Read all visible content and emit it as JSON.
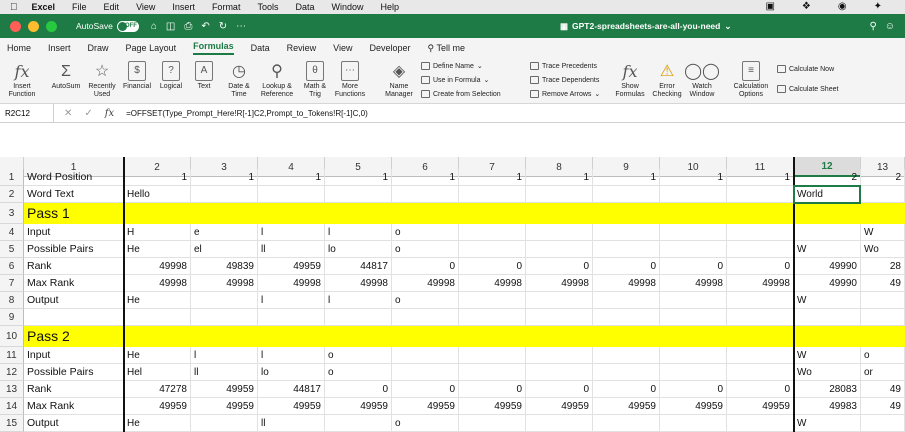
{
  "menubar": {
    "app": "Excel",
    "items": [
      "File",
      "Edit",
      "View",
      "Insert",
      "Format",
      "Tools",
      "Data",
      "Window",
      "Help"
    ]
  },
  "titlebar": {
    "autosave_label": "AutoSave",
    "autosave_state": "OFF",
    "doc_title": "GPT2-spreadsheets-are-all-you-need",
    "traffic_colors": [
      "#ff5f57",
      "#febc2e",
      "#28c840"
    ]
  },
  "tabs": [
    "Home",
    "Insert",
    "Draw",
    "Page Layout",
    "Formulas",
    "Data",
    "Review",
    "View",
    "Developer",
    "Tell me"
  ],
  "active_tab": "Formulas",
  "ribbon": {
    "insert_function": "Insert\nFunction",
    "autosum": "AutoSum",
    "recently_used": "Recently\nUsed",
    "financial": "Financial",
    "logical": "Logical",
    "text": "Text",
    "date_time": "Date &\nTime",
    "lookup": "Lookup &\nReference",
    "math": "Math &\nTrig",
    "more": "More\nFunctions",
    "name_manager": "Name\nManager",
    "define_name": "Define Name",
    "use_in_formula": "Use in Formula",
    "create_from_selection": "Create from Selection",
    "trace_precedents": "Trace Precedents",
    "trace_dependents": "Trace Dependents",
    "remove_arrows": "Remove Arrows",
    "show_formulas": "Show\nFormulas",
    "error_checking": "Error\nChecking",
    "watch_window": "Watch\nWindow",
    "calc_options": "Calculation\nOptions",
    "calculate_now": "Calculate Now",
    "calculate_sheet": "Calculate Sheet"
  },
  "formula_bar": {
    "name_box": "R2C12",
    "fx": "fx",
    "formula": "=OFFSET(Type_Prompt_Here!R[-1]C2,Prompt_to_Tokens!R[-1]C,0)"
  },
  "columns": [
    "1",
    "2",
    "3",
    "4",
    "5",
    "6",
    "7",
    "8",
    "9",
    "10",
    "11",
    "12",
    "13"
  ],
  "selected_column": "12",
  "rows": [
    {
      "num": "1",
      "cells": [
        "Word Position",
        "1",
        "1",
        "1",
        "1",
        "1",
        "1",
        "1",
        "1",
        "1",
        "1",
        "2",
        "2"
      ],
      "partial": true
    },
    {
      "num": "2",
      "cells": [
        "Word Text",
        "Hello",
        "",
        "",
        "",
        "",
        "",
        "",
        "",
        "",
        "",
        "World",
        ""
      ]
    },
    {
      "num": "3",
      "cells": [
        "Pass 1",
        "",
        "",
        "",
        "",
        "",
        "",
        "",
        "",
        "",
        "",
        "",
        ""
      ],
      "yellow": true
    },
    {
      "num": "4",
      "cells": [
        "Input",
        "H",
        "e",
        "l",
        "l",
        "o",
        "",
        "",
        "",
        "",
        "",
        "",
        "W"
      ]
    },
    {
      "num": "5",
      "cells": [
        "Possible Pairs",
        "He",
        "el",
        "ll",
        "lo",
        "o",
        "",
        "",
        "",
        "",
        "",
        "W",
        "Wo"
      ]
    },
    {
      "num": "6",
      "cells": [
        "Rank",
        "49998",
        "49839",
        "49959",
        "44817",
        "0",
        "0",
        "0",
        "0",
        "0",
        "0",
        "49990",
        "28"
      ],
      "numeric": true
    },
    {
      "num": "7",
      "cells": [
        "Max Rank",
        "49998",
        "49998",
        "49998",
        "49998",
        "49998",
        "49998",
        "49998",
        "49998",
        "49998",
        "49998",
        "49990",
        "49"
      ],
      "numeric": true
    },
    {
      "num": "8",
      "cells": [
        "Output",
        "He",
        "",
        "l",
        "l",
        "o",
        "",
        "",
        "",
        "",
        "",
        "W",
        ""
      ]
    },
    {
      "num": "9",
      "cells": [
        "",
        "",
        "",
        "",
        "",
        "",
        "",
        "",
        "",
        "",
        "",
        "",
        ""
      ]
    },
    {
      "num": "10",
      "cells": [
        "Pass 2",
        "",
        "",
        "",
        "",
        "",
        "",
        "",
        "",
        "",
        "",
        "",
        ""
      ],
      "yellow": true
    },
    {
      "num": "11",
      "cells": [
        "Input",
        "He",
        "l",
        "l",
        "o",
        "",
        "",
        "",
        "",
        "",
        "",
        "W",
        "o"
      ]
    },
    {
      "num": "12",
      "cells": [
        "Possible Pairs",
        "Hel",
        "ll",
        "lo",
        "o",
        "",
        "",
        "",
        "",
        "",
        "",
        "Wo",
        "or"
      ]
    },
    {
      "num": "13",
      "cells": [
        "Rank",
        "47278",
        "49959",
        "44817",
        "0",
        "0",
        "0",
        "0",
        "0",
        "0",
        "0",
        "28083",
        "49"
      ],
      "numeric": true
    },
    {
      "num": "14",
      "cells": [
        "Max Rank",
        "49959",
        "49959",
        "49959",
        "49959",
        "49959",
        "49959",
        "49959",
        "49959",
        "49959",
        "49959",
        "49983",
        "49"
      ],
      "numeric": true
    },
    {
      "num": "15",
      "cells": [
        "Output",
        "He",
        "",
        "ll",
        "",
        "o",
        "",
        "",
        "",
        "",
        "",
        "W",
        ""
      ],
      "partial_bottom": true
    }
  ],
  "selected_cell": {
    "row": "2",
    "col": "12"
  },
  "colors": {
    "excel_green": "#1e7b45",
    "highlight_yellow": "#ffff00"
  }
}
